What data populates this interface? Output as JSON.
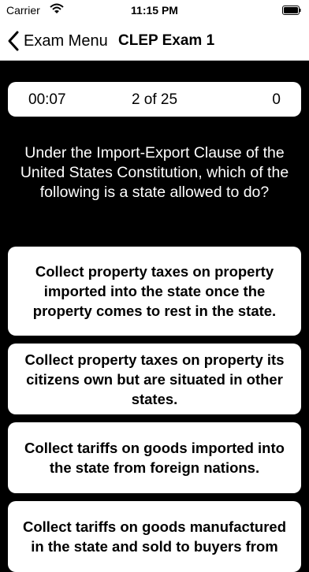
{
  "status_bar": {
    "carrier": "Carrier",
    "time": "11:15 PM"
  },
  "nav": {
    "back_label": "Exam Menu",
    "title": "CLEP Exam 1"
  },
  "stats": {
    "timer": "00:07",
    "progress": "2 of 25",
    "score": "0"
  },
  "question": "Under the Import-Export Clause of the United States Constitution, which of the following is a state allowed to do?",
  "answers": [
    "Collect property taxes on property imported into the state once the property comes to rest in the state.",
    "Collect property taxes on property its citizens own but are situated in other states.",
    "Collect tariffs on goods imported into the state from foreign nations.",
    "Collect tariffs on goods manufactured in the state and sold to buyers from"
  ]
}
